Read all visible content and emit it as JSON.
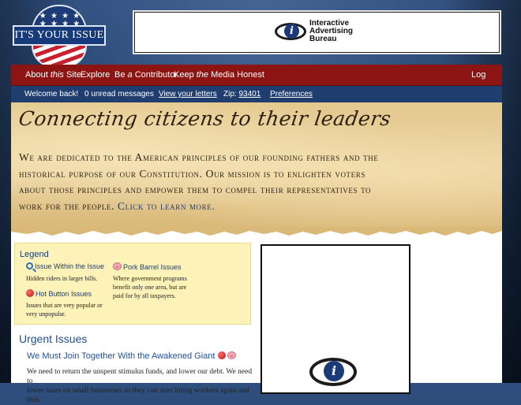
{
  "logo": {
    "text": "IT'S YOUR ISSUE",
    "stars": "★ ★ ★ ★ ★ ★ ★ ★"
  },
  "ad_banner": {
    "line1": "Interactive",
    "line2": "Advertising",
    "line3": "Bureau"
  },
  "nav_primary": {
    "items": [
      {
        "pre": "About ",
        "em": "this",
        "post": " Site"
      },
      {
        "label": "Explore"
      },
      {
        "pre": "Be ",
        "em": "a",
        "post": " Contributor"
      },
      {
        "pre": "Keep ",
        "em": "the",
        "post": " Media Honest"
      }
    ],
    "logout": "Log Out"
  },
  "nav_secondary": {
    "welcome": "Welcome back!",
    "unread": "0 unread messages",
    "view_letters": "View your letters",
    "zip_label": "Zip: ",
    "zip_value": "93401",
    "preferences": "Preferences"
  },
  "hero": {
    "tagline": "Connecting citizens to their leaders",
    "mission_l1": "We are dedicated to the American principles of our founding fathers and the",
    "mission_l2": "historical purpose of our Constitution. Our mission is to enlighten voters",
    "mission_l3": "about those principles and empower them to compel their representatives to",
    "mission_l4": "work for the people. ",
    "learn_more": "Click to learn more."
  },
  "legend": {
    "title": "Legend",
    "issue_within": {
      "name": "Issue Within the Issue",
      "desc": "Hidden riders in larger bills."
    },
    "pork_barrel": {
      "name": "Pork Barrel Issues",
      "desc1": "Where government programs",
      "desc2": "benefit only one area, but are",
      "desc3": "paid for by all taxpayers."
    },
    "hot_button": {
      "name": "Hot Button Issues",
      "desc1": "Issues that are very popular or",
      "desc2": "very unpopular."
    }
  },
  "urgent": {
    "heading": "Urgent Issues",
    "issue_title": "We Must Join Together With the Awakened Giant",
    "issue_body_l1": "We need to return the unspent stimulus funds, and lower our debt. We need to",
    "issue_body_l2": "lower taxes on small businesses so they can start hiring workers again and thus"
  }
}
